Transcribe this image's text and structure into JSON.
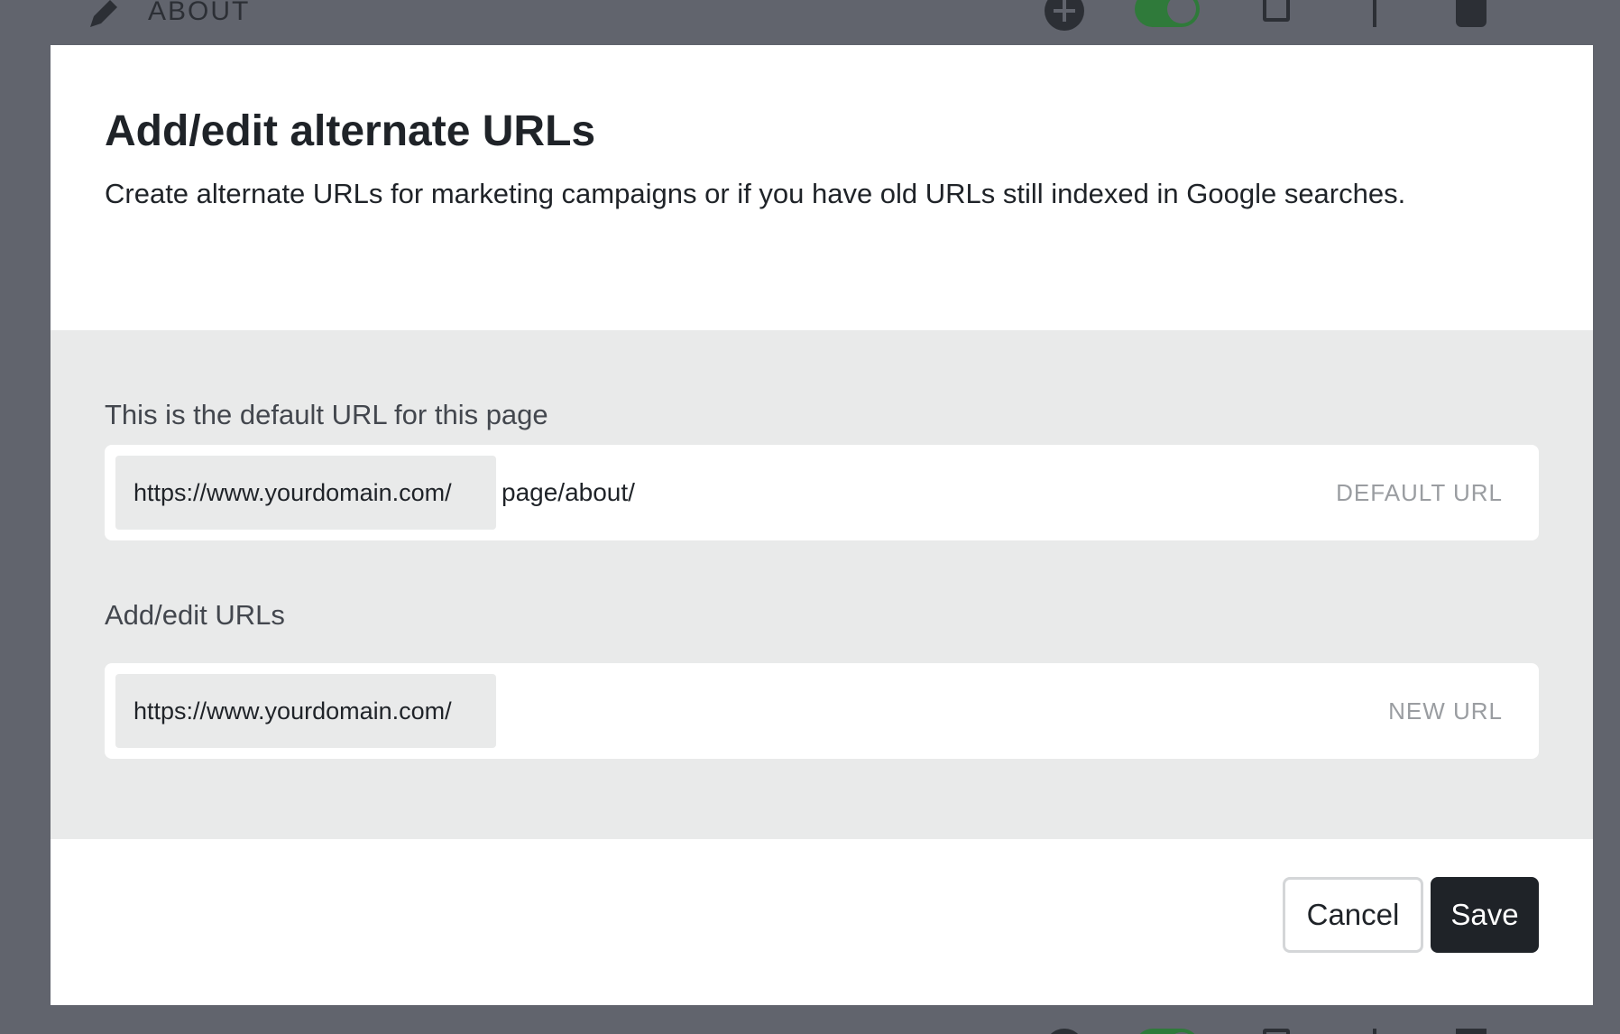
{
  "background": {
    "page_title": "ABOUT"
  },
  "modal": {
    "title": "Add/edit alternate URLs",
    "description": "Create alternate URLs for marketing campaigns or if you have old URLs still indexed in Google searches.",
    "default_url": {
      "label": "This is the default URL for this page",
      "prefix": "https://www.yourdomain.com/",
      "value": "page/about/",
      "tag": "DEFAULT URL"
    },
    "new_url": {
      "label": "Add/edit URLs",
      "prefix": "https://www.yourdomain.com/",
      "value": "",
      "tag": "NEW URL"
    },
    "cancel_label": "Cancel",
    "save_label": "Save"
  },
  "colors": {
    "overlay": "#61646d",
    "body_bg": "#e9eaea",
    "primary_button": "#1f2328",
    "toggle_on": "#2f7a3a"
  }
}
